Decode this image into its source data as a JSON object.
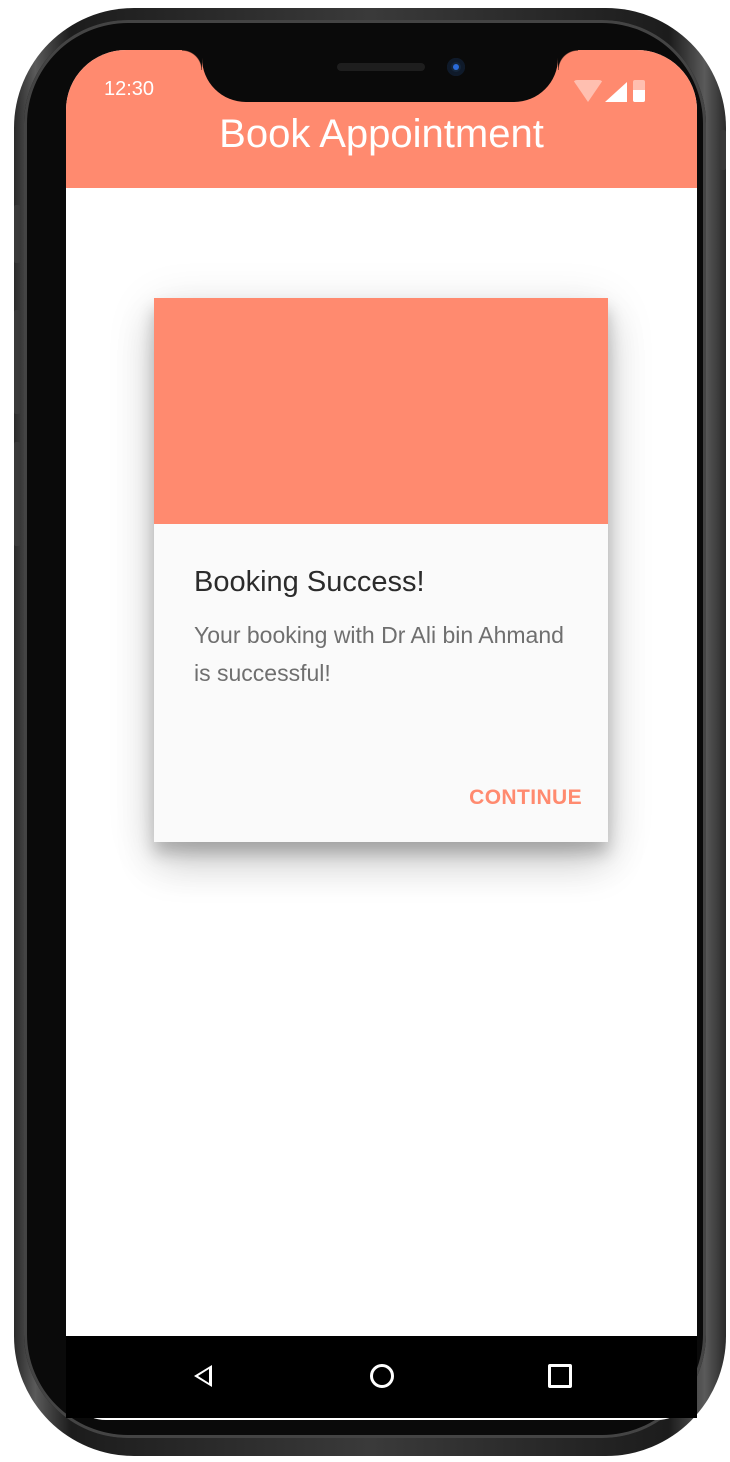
{
  "status_bar": {
    "time": "12:30",
    "wifi_icon": "wifi-icon",
    "signal_icon": "signal-icon",
    "battery_icon": "battery-icon"
  },
  "app_bar": {
    "title": "Book Appointment"
  },
  "dialog": {
    "title": "Booking Success!",
    "message": "Your booking with Dr Ali bin Ahmand is successful!",
    "continue_label": "CONTINUE"
  },
  "nav_bar": {
    "back_icon": "back-triangle-icon",
    "home_icon": "home-circle-icon",
    "recents_icon": "recents-square-icon"
  },
  "colors": {
    "accent": "#FF8A6F",
    "dialog_background": "#FAFAFA",
    "title_text": "#2B2B2B",
    "body_text": "#6F6F6F"
  }
}
